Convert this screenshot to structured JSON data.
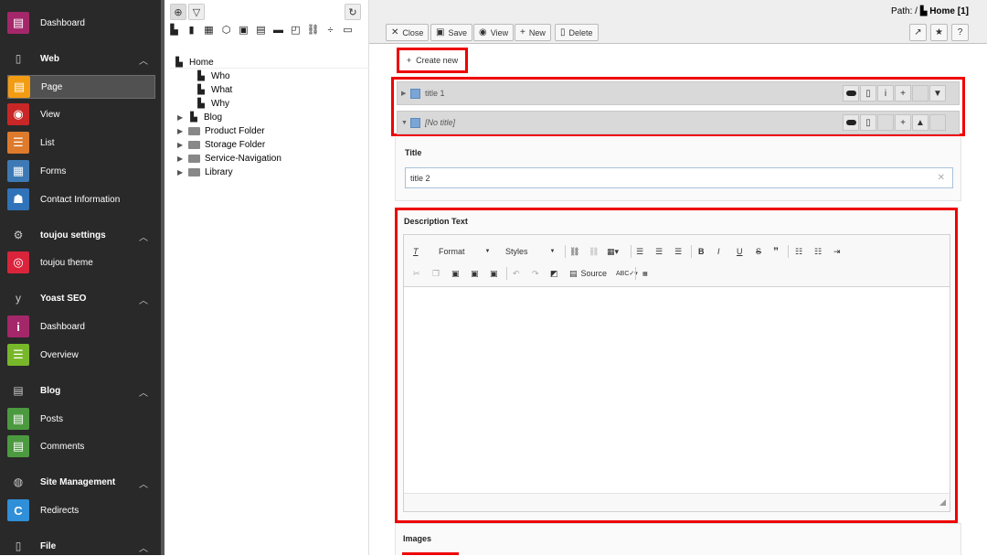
{
  "module_menu": {
    "items": [
      {
        "type": "item",
        "label": "Dashboard",
        "icon": "dashboard-icon",
        "color": "#a4276a",
        "glyph": "▤"
      },
      {
        "type": "group",
        "label": "Web",
        "icon": "file-icon",
        "glyph": "▯"
      },
      {
        "type": "item",
        "label": "Page",
        "icon": "page-icon",
        "color": "#f39c12",
        "glyph": "▤",
        "active": true
      },
      {
        "type": "item",
        "label": "View",
        "icon": "eye-icon",
        "color": "#c92727",
        "glyph": "◉"
      },
      {
        "type": "item",
        "label": "List",
        "icon": "list-icon",
        "color": "#dd7a2c",
        "glyph": "☰"
      },
      {
        "type": "item",
        "label": "Forms",
        "icon": "forms-icon",
        "color": "#3d7ab5",
        "glyph": "▦"
      },
      {
        "type": "item",
        "label": "Contact Information",
        "icon": "contact-icon",
        "color": "#3073b8",
        "glyph": "☗"
      },
      {
        "type": "group",
        "label": "toujou settings",
        "icon": "gear-icon",
        "glyph": "⚙"
      },
      {
        "type": "item",
        "label": "toujou theme",
        "icon": "fingerprint-icon",
        "color": "#d9243c",
        "glyph": "◎"
      },
      {
        "type": "group",
        "label": "Yoast SEO",
        "icon": "yoast-icon",
        "glyph": "y"
      },
      {
        "type": "item",
        "label": "Dashboard",
        "icon": "info-icon",
        "color": "#a4276a",
        "glyph": "i"
      },
      {
        "type": "item",
        "label": "Overview",
        "icon": "overview-icon",
        "color": "#78b72a",
        "glyph": "☰"
      },
      {
        "type": "group",
        "label": "Blog",
        "icon": "blog-icon",
        "glyph": "▤"
      },
      {
        "type": "item",
        "label": "Posts",
        "icon": "posts-icon",
        "color": "#4c9a3f",
        "glyph": "▤"
      },
      {
        "type": "item",
        "label": "Comments",
        "icon": "comments-icon",
        "color": "#4c9a3f",
        "glyph": "▤"
      },
      {
        "type": "group",
        "label": "Site Management",
        "icon": "globe-icon",
        "glyph": "◍"
      },
      {
        "type": "item",
        "label": "Redirects",
        "icon": "redirect-icon",
        "color": "#2f8fd8",
        "glyph": "C"
      },
      {
        "type": "group",
        "label": "File",
        "icon": "file-icon",
        "glyph": "▯"
      }
    ]
  },
  "tree": {
    "root": "Home",
    "nodes": [
      {
        "label": "Who",
        "indent": 1,
        "kind": "page"
      },
      {
        "label": "What",
        "indent": 1,
        "kind": "page"
      },
      {
        "label": "Why",
        "indent": 1,
        "kind": "page"
      },
      {
        "label": "Blog",
        "indent": 0,
        "kind": "page",
        "toggle": true
      },
      {
        "label": "Product Folder",
        "indent": 0,
        "kind": "folder",
        "toggle": true
      },
      {
        "label": "Storage Folder",
        "indent": 0,
        "kind": "folder",
        "toggle": true
      },
      {
        "label": "Service-Navigation",
        "indent": 0,
        "kind": "folder",
        "toggle": true
      },
      {
        "label": "Library",
        "indent": 0,
        "kind": "folder",
        "toggle": true
      }
    ]
  },
  "header": {
    "path_label": "Path: /",
    "path_page": "Home [1]",
    "buttons": {
      "close": "Close",
      "save": "Save",
      "view": "View",
      "new": "New",
      "delete": "Delete"
    }
  },
  "content": {
    "create_new": "Create new",
    "records": [
      {
        "title": "title 1",
        "italic": false
      },
      {
        "title": "[No title]",
        "italic": true
      }
    ],
    "title_label": "Title",
    "title_value": "title 2",
    "description_label": "Description Text",
    "editor": {
      "format_label": "Format",
      "styles_label": "Styles",
      "source_label": "Source"
    },
    "images_label": "Images"
  }
}
